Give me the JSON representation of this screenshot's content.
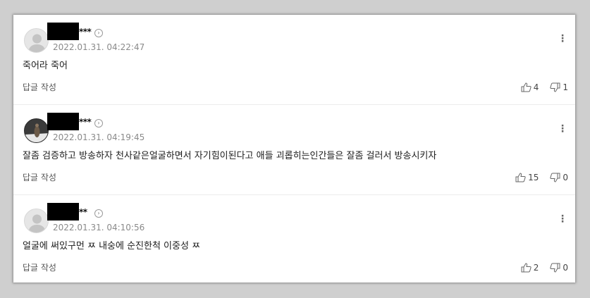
{
  "comments": [
    {
      "stars": "***",
      "arrow": "›",
      "date": "2022.01.31. 04:22:47",
      "text": "죽어라 죽어",
      "reply_label": "답글 작성",
      "more": "⋮",
      "likes": "4",
      "dislikes": "1",
      "avatar": "default-avatar-icon"
    },
    {
      "stars": "***",
      "arrow": "›",
      "date": "2022.01.31. 04:19:45",
      "text": "잘좀 검증하고 방송하자 천사같은얼굴하면서 자기힘이된다고 애들 괴롭히는인간들은 잘좀 걸러서 방송시키자",
      "reply_label": "답글 작성",
      "more": "⋮",
      "likes": "15",
      "dislikes": "0",
      "avatar": "photo-avatar"
    },
    {
      "stars": "**",
      "arrow": "›",
      "date": "2022.01.31. 04:10:56",
      "text": "얼굴에 써있구먼 ㅉ 내숭에 순진한척 이중성 ㅉ",
      "reply_label": "답글 작성",
      "more": "⋮",
      "likes": "2",
      "dislikes": "0",
      "avatar": "default-avatar-icon"
    }
  ],
  "colors": {
    "background": "#cfcfcf",
    "card": "#ffffff",
    "date": "#8a8a8a",
    "nickname_redaction": "#000000"
  }
}
